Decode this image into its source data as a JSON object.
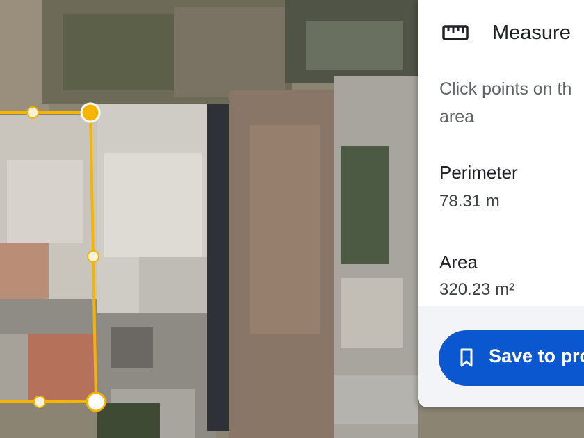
{
  "panel": {
    "title": "Measure",
    "title_icon": "ruler-icon",
    "instructions": "Click points on th\narea",
    "perimeter_label": "Perimeter",
    "perimeter_value": "78.31 m",
    "area_label": "Area",
    "area_value": "320.23 m²",
    "save_label": "Save to pro",
    "save_icon": "bookmark-icon"
  },
  "colors": {
    "measure_line": "#f4b400",
    "save_button": "#0b57d0",
    "panel_bg": "#ffffff"
  }
}
